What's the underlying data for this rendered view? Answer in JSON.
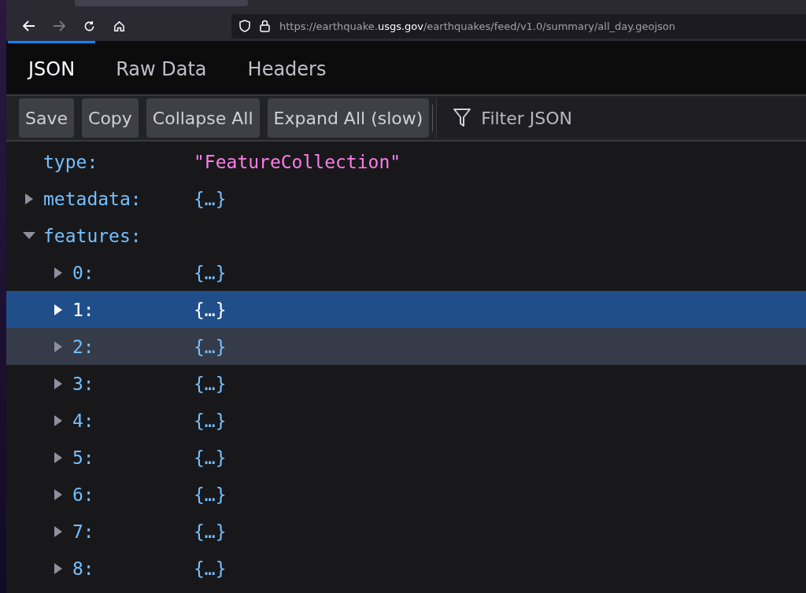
{
  "address_bar": {
    "url_prefix": "https://earthquake.",
    "url_domain": "usgs.gov",
    "url_path": "/earthquakes/feed/v1.0/summary/all_day.geojson"
  },
  "tabs": [
    {
      "label": "JSON",
      "selected": true
    },
    {
      "label": "Raw Data",
      "selected": false
    },
    {
      "label": "Headers",
      "selected": false
    }
  ],
  "toolbar": {
    "buttons": [
      "Save",
      "Copy",
      "Collapse All",
      "Expand All (slow)"
    ],
    "filter": {
      "placeholder": "Filter JSON"
    }
  },
  "tree": [
    {
      "key": "type:",
      "value": "\"FeatureCollection\"",
      "kind": "string",
      "selected": false,
      "hovered": false
    },
    {
      "key": "metadata:",
      "value": "{…}",
      "kind": "object",
      "expanded": false,
      "selected": false,
      "hovered": false
    },
    {
      "key": "features:",
      "expanded": true,
      "selected": false,
      "hovered": false,
      "children": [
        {
          "key": "0:",
          "value": "{…}",
          "kind": "object",
          "expanded": false,
          "selected": false,
          "hovered": false
        },
        {
          "key": "1:",
          "value": "{…}",
          "kind": "object",
          "expanded": false,
          "selected": true,
          "hovered": false
        },
        {
          "key": "2:",
          "value": "{…}",
          "kind": "object",
          "expanded": false,
          "selected": false,
          "hovered": true
        },
        {
          "key": "3:",
          "value": "{…}",
          "kind": "object",
          "expanded": false,
          "selected": false,
          "hovered": false
        },
        {
          "key": "4:",
          "value": "{…}",
          "kind": "object",
          "expanded": false,
          "selected": false,
          "hovered": false
        },
        {
          "key": "5:",
          "value": "{…}",
          "kind": "object",
          "expanded": false,
          "selected": false,
          "hovered": false
        },
        {
          "key": "6:",
          "value": "{…}",
          "kind": "object",
          "expanded": false,
          "selected": false,
          "hovered": false
        },
        {
          "key": "7:",
          "value": "{…}",
          "kind": "object",
          "expanded": false,
          "selected": false,
          "hovered": false
        },
        {
          "key": "8:",
          "value": "{…}",
          "kind": "object",
          "expanded": false,
          "selected": false,
          "hovered": false
        }
      ]
    }
  ]
}
